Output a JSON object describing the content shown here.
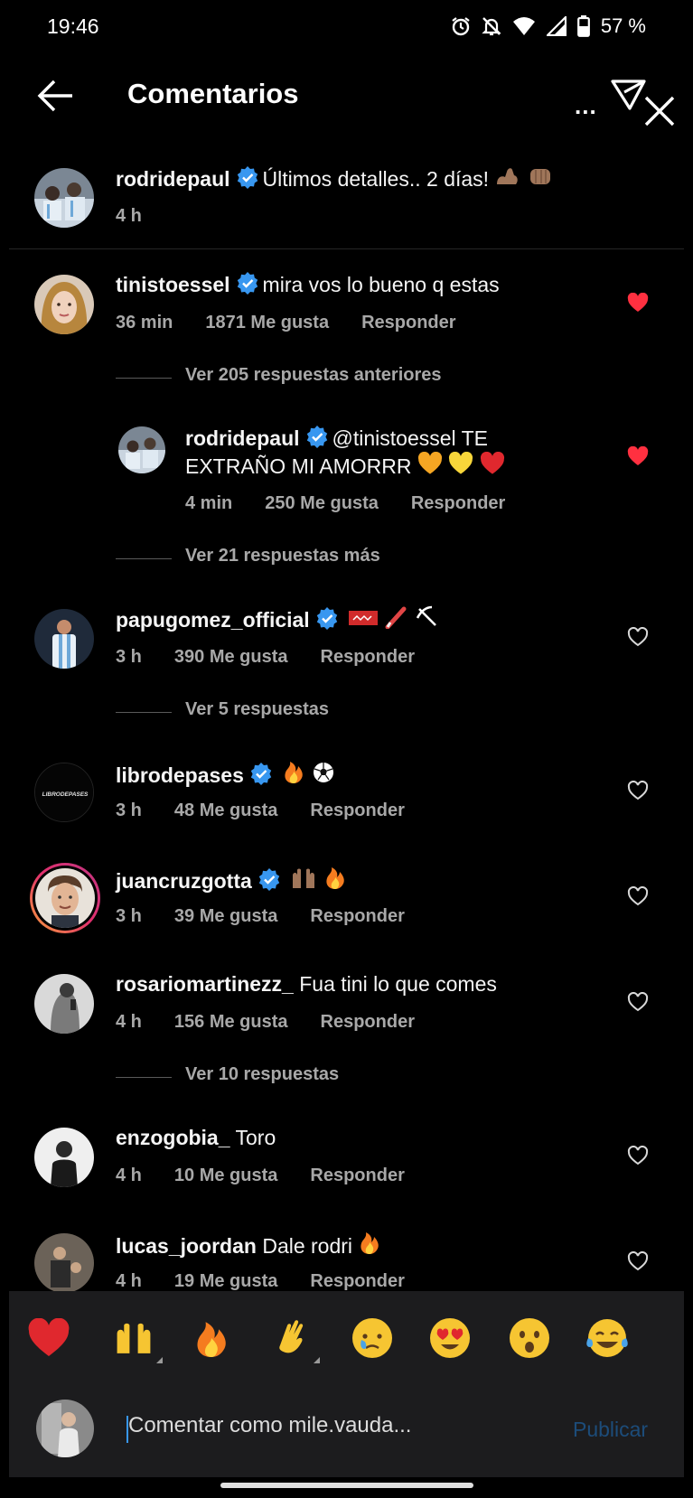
{
  "status_bar": {
    "time": "19:46",
    "battery": "57 %",
    "icons": [
      "alarm-icon",
      "notifications-off-icon",
      "wifi-icon",
      "signal-icon",
      "battery-icon"
    ]
  },
  "header": {
    "title": "Comentarios",
    "more_label": "...",
    "icons": [
      "back-arrow-icon",
      "send-icon"
    ]
  },
  "caption": {
    "username": "rodridepaul",
    "text": "Últimos detalles.. 2 días!",
    "emojis": [
      "flexed-biceps",
      "oncoming-fist"
    ],
    "time": "4 h"
  },
  "comments": [
    {
      "username": "tinistoessel",
      "text": "mira vos lo bueno q estas",
      "time": "36 min",
      "likes": "1871 Me gusta",
      "reply": "Responder",
      "liked": true,
      "previous_replies": "Ver 205 respuestas anteriores",
      "reply_item": {
        "username": "rodridepaul",
        "text_line1": "@tinistoessel TE",
        "text_line2": "EXTRAÑO MI AMORRR",
        "emojis": [
          "orange-heart",
          "yellow-heart",
          "red-heart"
        ],
        "time": "4 min",
        "likes": "250 Me gusta",
        "reply": "Responder",
        "liked": true
      },
      "more_replies": "Ver 21 respuestas más"
    },
    {
      "username": "papugomez_official",
      "text": "",
      "emojis": [
        "tag-flag",
        "pen-icon",
        "pickaxe"
      ],
      "time": "3 h",
      "likes": "390 Me gusta",
      "reply": "Responder",
      "replies": "Ver 5 respuestas"
    },
    {
      "username": "librodepases",
      "avatar_text": "LIBRODEPASES",
      "text": "",
      "emojis": [
        "fire",
        "soccer-ball"
      ],
      "time": "3 h",
      "likes": "48 Me gusta",
      "reply": "Responder"
    },
    {
      "username": "juancruzgotta",
      "text": "",
      "emojis": [
        "raising-hands",
        "fire"
      ],
      "time": "3 h",
      "likes": "39 Me gusta",
      "reply": "Responder"
    },
    {
      "username": "rosariomartinezz_",
      "text": "Fua tini lo que comes",
      "time": "4 h",
      "likes": "156 Me gusta",
      "reply": "Responder",
      "replies": "Ver 10 respuestas"
    },
    {
      "username": "enzogobia_",
      "text": "Toro",
      "time": "4 h",
      "likes": "10 Me gusta",
      "reply": "Responder"
    },
    {
      "username": "lucas_joordan",
      "text": "Dale rodri",
      "emojis": [
        "fire"
      ],
      "time": "4 h",
      "likes": "19 Me gusta",
      "reply": "Responder"
    }
  ],
  "reactions": [
    "red-heart",
    "raising-hands",
    "fire",
    "clapping-hands",
    "crying-face",
    "heart-eyes",
    "astonished-face",
    "tears-of-joy"
  ],
  "input": {
    "placeholder": "Comentar como mile.vauda...",
    "publish_label": "Publicar"
  },
  "colors": {
    "background": "#000000",
    "text": "#f5f5f5",
    "secondary_text": "#a8a8a8",
    "like_red": "#ff3040",
    "verified_blue": "#3897f0",
    "publish_disabled": "#1c4c7a"
  }
}
